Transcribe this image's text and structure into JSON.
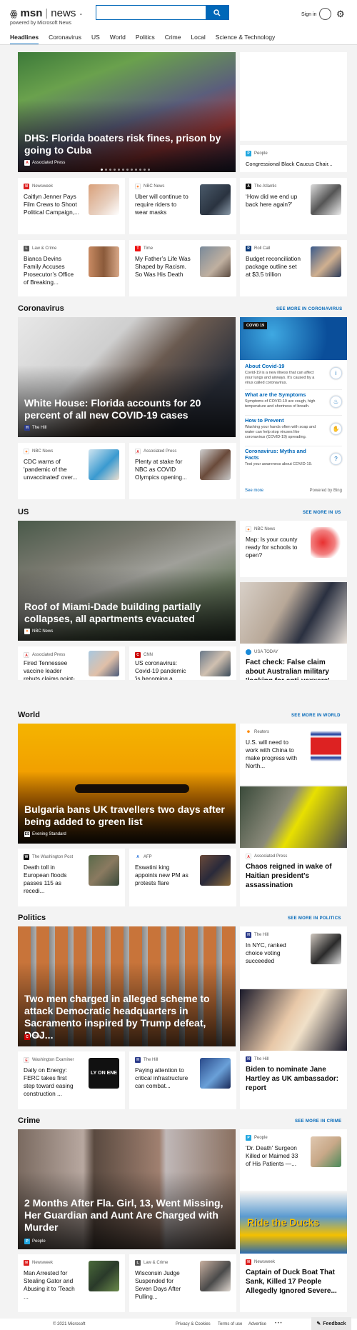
{
  "header": {
    "brand_msn": "msn",
    "brand_news": "news",
    "brand_sub": "powered by Microsoft News",
    "search_value": "",
    "signin": "Sign in"
  },
  "nav": [
    "Headlines",
    "Coronavirus",
    "US",
    "World",
    "Politics",
    "Crime",
    "Local",
    "Science & Technology"
  ],
  "headlines": {
    "hero": {
      "title": "DHS: Florida boaters risk fines, prison by going to Cuba",
      "source": "Associated Press"
    },
    "side": {
      "source": "People",
      "title": "Congressional Black Caucus Chair..."
    },
    "cards": [
      {
        "source": "Newsweek",
        "title": "Caitlyn Jenner Pays Film Crews to Shoot Political Campaign,..."
      },
      {
        "source": "NBC News",
        "title": "Uber will continue to require riders to wear masks"
      },
      {
        "source": "The Atlantic",
        "title": "‘How did we end up back here again?’"
      },
      {
        "source": "Law & Crime",
        "title": "Bianca Devins Family Accuses Prosecutor’s Office of Breaking..."
      },
      {
        "source": "Time",
        "title": "My Father’s Life Was Shaped by Racism. So Was His Death"
      },
      {
        "source": "Roll Call",
        "title": "Budget reconciliation package outline set at $3.5 trillion"
      }
    ]
  },
  "coronavirus": {
    "heading": "Coronavirus",
    "see_more": "SEE MORE IN CORONAVIRUS",
    "hero": {
      "title": "White House: Florida accounts for 20 percent of all new COVID-19 cases",
      "source": "The Hill"
    },
    "cards": [
      {
        "source": "NBC News",
        "title": "CDC warns of 'pandemic of the unvaccinated' over..."
      },
      {
        "source": "Associated Press",
        "title": "Plenty at stake for NBC as COVID Olympics opening..."
      }
    ],
    "panel": {
      "badge": "COVID 19",
      "items": [
        {
          "title": "About Covid-19",
          "text": "Covid-19 is a new illness that can affect your lungs and airways. It's caused by a virus called coronavirus."
        },
        {
          "title": "What are the Symptoms",
          "text": "Symptoms of COVID-19 are cough, high temperature and shortness of breath."
        },
        {
          "title": "How to Prevent",
          "text": "Washing your hands often with soap and water can help stop viruses like coronavirus (COVID-19) spreading."
        },
        {
          "title": "Coronavirus: Myths and Facts",
          "text": "Test your awareness about COVID-19."
        }
      ],
      "see_more": "See more",
      "powered": "Powered by Bing"
    }
  },
  "us": {
    "heading": "US",
    "see_more": "SEE MORE IN US",
    "hero": {
      "title": "Roof of Miami-Dade building partially collapses, all apartments evacuated",
      "source": "NBC News"
    },
    "side": {
      "source": "NBC News",
      "title": "Map: Is your county ready for schools to open?"
    },
    "cards": [
      {
        "source": "Associated Press",
        "title": "Fired Tennessee vaccine leader rebuts claims point-by-point"
      },
      {
        "source": "CNN",
        "title": "US coronavirus: Covid-19 pandemic 'is becoming a pande..."
      }
    ],
    "tall": {
      "source": "USA TODAY",
      "title": "Fact check: False claim about Australian military 'looking for anti-vaxxers'"
    }
  },
  "world": {
    "heading": "World",
    "see_more": "SEE MORE IN WORLD",
    "hero": {
      "title": "Bulgaria bans UK travellers two days after being added to green list",
      "source": "Evening Standard"
    },
    "side": {
      "source": "Reuters",
      "title": "U.S. will need to work with China to make progress with North..."
    },
    "cards": [
      {
        "source": "The Washington Post",
        "title": "Death toll in European floods passes 115 as recedi..."
      },
      {
        "source": "AFP",
        "title": "Eswatini king appoints new PM as protests flare"
      }
    ],
    "tall": {
      "source": "Associated Press",
      "title": "Chaos reigned in wake of Haitian president's assassination"
    }
  },
  "politics": {
    "heading": "Politics",
    "see_more": "SEE MORE IN POLITICS",
    "hero": {
      "title": "Two men charged in alleged scheme to attack Democratic headquarters in Sacramento inspired by Trump defeat, DOJ...",
      "source": "CNN"
    },
    "side": {
      "source": "The Hill",
      "title": "In NYC, ranked choice voting succeeded"
    },
    "cards": [
      {
        "source": "Washington Examiner",
        "title": "Daily on Energy: FERC takes first step toward easing construction ...",
        "thumb_text": "LY ON ENE"
      },
      {
        "source": "The Hill",
        "title": "Paying attention to critical infrastructure can combat..."
      }
    ],
    "tall": {
      "source": "The Hill",
      "title": "Biden to nominate Jane Hartley as UK ambassador: report"
    }
  },
  "crime": {
    "heading": "Crime",
    "see_more": "SEE MORE IN CRIME",
    "hero": {
      "title": "2 Months After Fla. Girl, 13, Went Missing, Her Guardian and Aunt Are Charged with Murder",
      "source": "People"
    },
    "side": {
      "source": "People",
      "title": "'Dr. Death' Surgeon Killed or Maimed 33 of His Patients —..."
    },
    "cards": [
      {
        "source": "Newsweek",
        "title": "Man Arrested for Stealing Gator and Abusing it to 'Teach ..."
      },
      {
        "source": "Law & Crime",
        "title": "Wisconsin Judge Suspended for Seven Days After Pulling..."
      }
    ],
    "tall": {
      "source": "Newsweek",
      "title": "Captain of Duck Boat That Sank, Killed 17 People Allegedly Ignored Severe...",
      "img_text": "Ride the Ducks"
    }
  },
  "footer": {
    "copyright": "© 2021 Microsoft",
    "privacy": "Privacy & Cookies",
    "terms": "Terms of use",
    "advertise": "Advertise",
    "more": "• • •",
    "feedback": "Feedback"
  },
  "colors": {
    "accent": "#0067b8",
    "page_bg": "#f3f3f3"
  }
}
